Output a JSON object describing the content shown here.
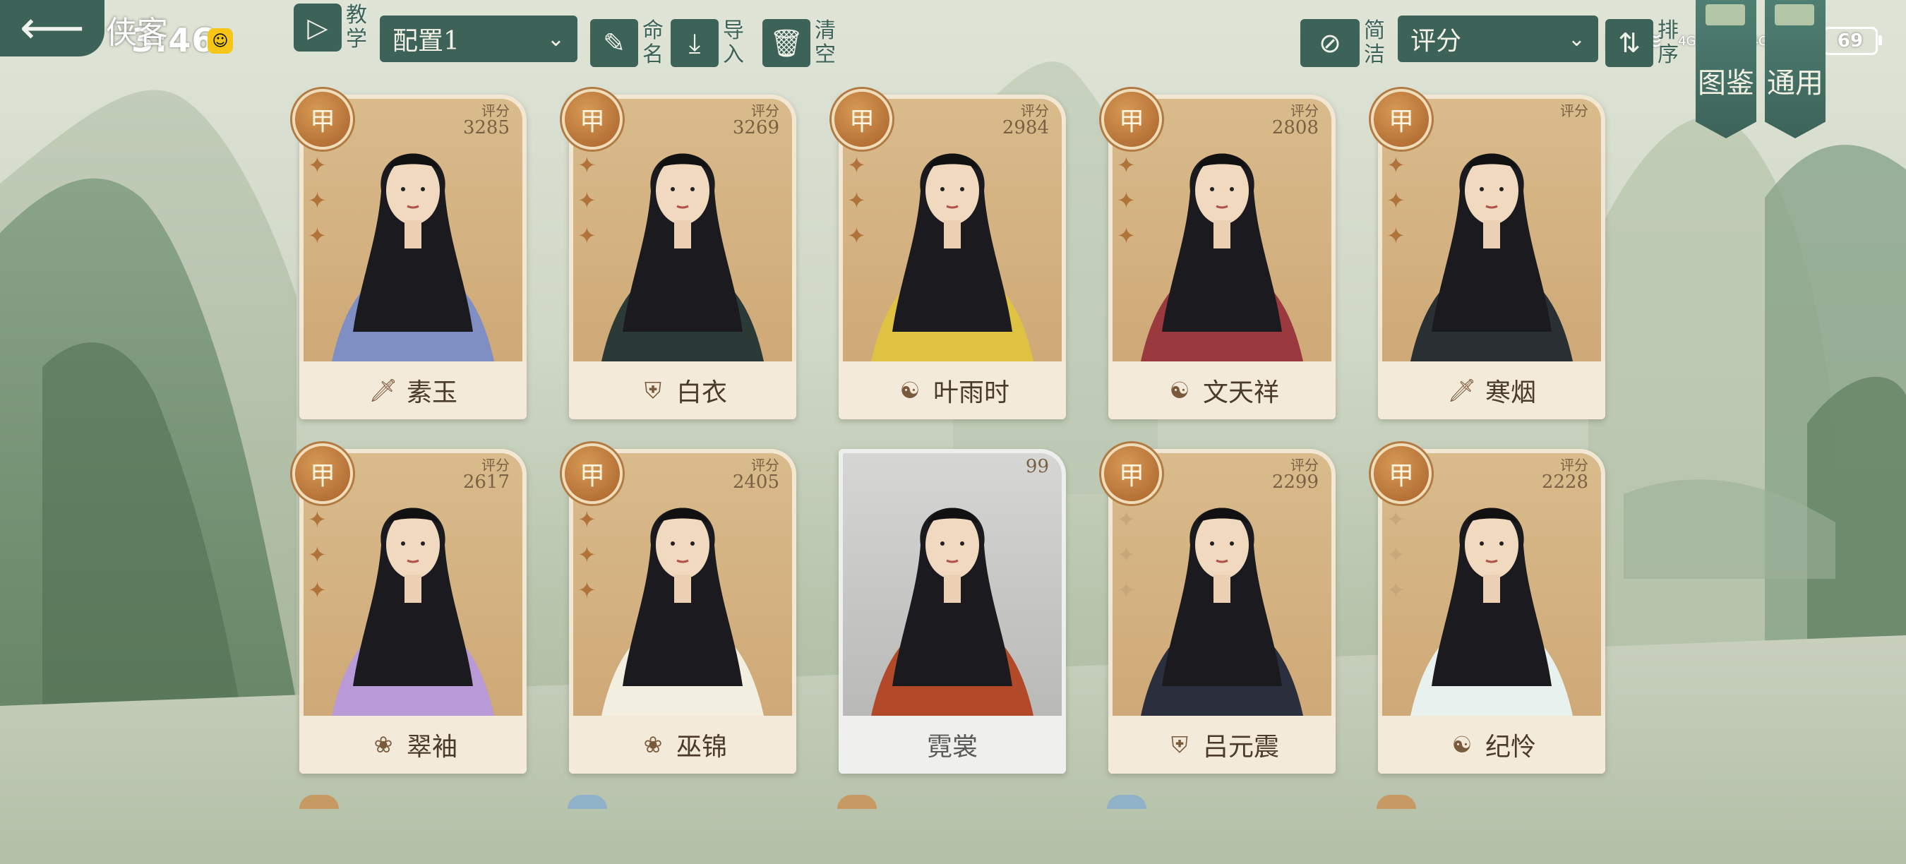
{
  "status_bar": {
    "time": "3:46",
    "network_left": "4G",
    "network_right": "4G",
    "battery": "69"
  },
  "header": {
    "title": "侠客",
    "tutorial_label": "教学",
    "config_select": "配置1",
    "rename_label": "命名",
    "import_label": "导入",
    "clear_label": "清空",
    "simple_label": "简洁",
    "sort_select": "评分",
    "sort_label": "排序"
  },
  "banners": {
    "atlas": "图鉴",
    "general": "通用"
  },
  "cards": [
    {
      "rank": "甲",
      "score_label": "评分",
      "score": "3285",
      "name": "素玉",
      "sect_icon": "sword-icon",
      "stars": 3,
      "style": "gold"
    },
    {
      "rank": "甲",
      "score_label": "评分",
      "score": "3269",
      "name": "白衣",
      "sect_icon": "shield-icon",
      "stars": 3,
      "style": "gold"
    },
    {
      "rank": "甲",
      "score_label": "评分",
      "score": "2984",
      "name": "叶雨时",
      "sect_icon": "yinyang-icon",
      "stars": 3,
      "style": "gold"
    },
    {
      "rank": "甲",
      "score_label": "评分",
      "score": "2808",
      "name": "文天祥",
      "sect_icon": "yinyang-icon",
      "stars": 3,
      "style": "gold"
    },
    {
      "rank": "甲",
      "score_label": "评分",
      "score": "",
      "name": "寒烟",
      "sect_icon": "sword-icon",
      "stars": 3,
      "style": "gold"
    },
    {
      "rank": "甲",
      "score_label": "评分",
      "score": "2617",
      "name": "翠袖",
      "sect_icon": "lotus-icon",
      "stars": 3,
      "style": "gold"
    },
    {
      "rank": "甲",
      "score_label": "评分",
      "score": "2405",
      "name": "巫锦",
      "sect_icon": "lotus-icon",
      "stars": 3,
      "style": "gold"
    },
    {
      "rank": "",
      "score_label": "",
      "score": "99",
      "name": "霓裳",
      "sect_icon": "",
      "stars": 0,
      "style": "grey"
    },
    {
      "rank": "甲",
      "score_label": "评分",
      "score": "2299",
      "name": "吕元震",
      "sect_icon": "shield-icon",
      "stars": 0,
      "style": "gold"
    },
    {
      "rank": "甲",
      "score_label": "评分",
      "score": "2228",
      "name": "纪怜",
      "sect_icon": "yinyang-icon",
      "stars": 0,
      "style": "gold"
    }
  ],
  "colors": {
    "accent": "#3d6359",
    "card_bg": "#f2e7d3",
    "rank_badge": "#b5713a"
  }
}
